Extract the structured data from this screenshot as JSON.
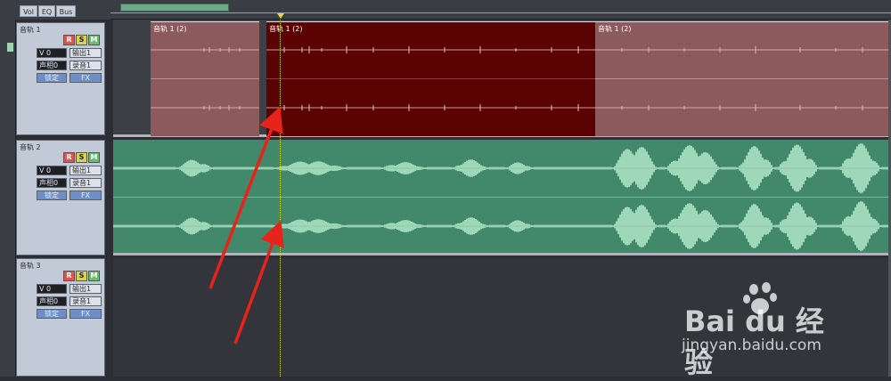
{
  "tabs": [
    {
      "label": "Vol"
    },
    {
      "label": "EQ"
    },
    {
      "label": "Bus"
    }
  ],
  "tracks": [
    {
      "name": "音轨 1",
      "rec": "R",
      "solo": "S",
      "mute": "M",
      "volume": "V 0",
      "output": "输出1",
      "pan": "声相0",
      "input": "录音1",
      "lock": "锁定",
      "fx": "FX"
    },
    {
      "name": "音轨 2",
      "rec": "R",
      "solo": "S",
      "mute": "M",
      "volume": "V 0",
      "output": "输出1",
      "pan": "声相0",
      "input": "录音1",
      "lock": "锁定",
      "fx": "FX"
    },
    {
      "name": "音轨 3",
      "rec": "R",
      "solo": "S",
      "mute": "M",
      "volume": "V 0",
      "output": "输出1",
      "pan": "声相0",
      "input": "录音1",
      "lock": "锁定",
      "fx": "FX"
    }
  ],
  "clips": [
    {
      "label": "音轨 1 (2)",
      "state": "normal"
    },
    {
      "label": "音轨 1 (2)",
      "state": "selected"
    },
    {
      "label": "音轨 1 (2)",
      "state": "normal"
    }
  ],
  "colors": {
    "clip_normal": "#8c5a5d",
    "clip_selected": "#5b0202",
    "track2_lane": "#41896a",
    "waveform_green": "#9fd8b8",
    "arrow": "#e8231c"
  },
  "watermark": {
    "brand": "Bai du 经验",
    "url": "jingyan.baidu.com"
  }
}
